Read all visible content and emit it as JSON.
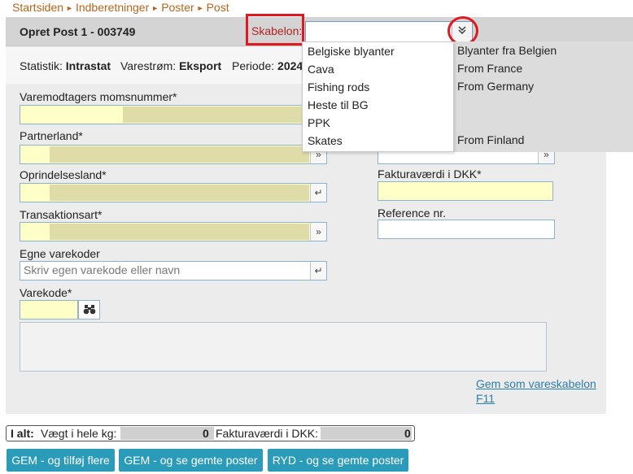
{
  "breadcrumb": [
    "Startsiden",
    "Indberetninger",
    "Poster",
    "Post"
  ],
  "header": {
    "title": "Opret Post 1 - 003749"
  },
  "template": {
    "label": "Skabelon:",
    "value": ""
  },
  "info": {
    "statistik_label": "Statistik:",
    "statistik_value": "Intrastat",
    "varestrom_label": "Varestrøm:",
    "varestrom_value": "Eksport",
    "periode_label": "Periode:",
    "periode_value": "2024"
  },
  "dropdown": {
    "items": [
      {
        "name": "Belgiske blyanter",
        "desc": "Blyanter fra Belgien"
      },
      {
        "name": "Cava",
        "desc": "From France"
      },
      {
        "name": "Fishing rods",
        "desc": "From Germany"
      },
      {
        "name": "Heste til BG",
        "desc": ""
      },
      {
        "name": "PPK",
        "desc": ""
      },
      {
        "name": "Skates",
        "desc": "From Finland"
      }
    ]
  },
  "form": {
    "momsnummer_label": "Varemodtagers momsnummer*",
    "partnerland_label": "Partnerland*",
    "oprindelsesland_label": "Oprindelsesland*",
    "transaktionsart_label": "Transaktionsart*",
    "egne_label": "Egne varekoder",
    "egne_placeholder": "Skriv egen varekode eller navn",
    "varekode_label": "Varekode*",
    "fakturavaerdi_label": "Fakturaværdi i DKK*",
    "reference_label": "Reference nr.",
    "gem_link_line1": "Gem som vareskabelon",
    "gem_link_line2": "F11"
  },
  "totals": {
    "label": "I alt:",
    "weight_label": "Vægt i hele kg:",
    "weight_value": "0",
    "invoice_label": "Fakturaværdi i DKK:",
    "invoice_value": "0"
  },
  "buttons": {
    "save_add": "GEM - og tilføj flere",
    "save_view": "GEM - og se gemte poster",
    "clear_view": "RYD - og se gemte poster"
  },
  "icons": {
    "dropdown": "chevron-double-down-icon",
    "lookup": "corner-arrow-icon",
    "search": "binoculars-icon"
  }
}
